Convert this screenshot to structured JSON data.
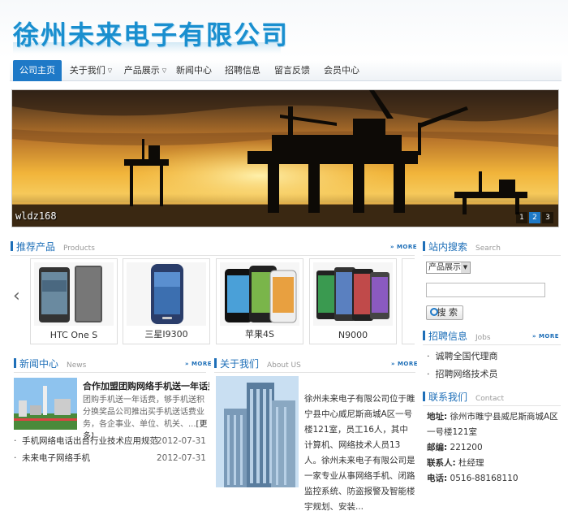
{
  "header": {
    "company_name": "徐州未来电子有限公司"
  },
  "nav": {
    "items": [
      {
        "label": "公司主页",
        "active": true
      },
      {
        "label": "关于我们",
        "dropdown": true
      },
      {
        "label": "产品展示",
        "dropdown": true
      },
      {
        "label": "新闻中心"
      },
      {
        "label": "招聘信息"
      },
      {
        "label": "留言反馈"
      },
      {
        "label": "会员中心"
      }
    ]
  },
  "banner": {
    "caption": "wldz168",
    "pages": [
      "1",
      "2",
      "3"
    ],
    "current_page": "2"
  },
  "products": {
    "title": "推荐产品",
    "title_en": "Products",
    "more": "MORE",
    "items": [
      {
        "name": "HTC One S"
      },
      {
        "name": "三星I9300"
      },
      {
        "name": "苹果4S"
      },
      {
        "name": "N9000"
      }
    ]
  },
  "search": {
    "title": "站内搜索",
    "title_en": "Search",
    "category": "产品展示",
    "button": "搜 索"
  },
  "jobs": {
    "title": "招聘信息",
    "title_en": "Jobs",
    "more": "MORE",
    "items": [
      "诚聘全国代理商",
      "招聘网络技术员"
    ]
  },
  "contact": {
    "title": "联系我们",
    "title_en": "Contact",
    "address_label": "地址:",
    "address": "徐州市睢宁县威尼斯商城A区一号楼121室",
    "zip_label": "邮编:",
    "zip": "221200",
    "person_label": "联系人:",
    "person": "杜经理",
    "phone_label": "电话:",
    "phone": "0516-88168110"
  },
  "news": {
    "title": "新闻中心",
    "title_en": "News",
    "more": "MORE",
    "featured_title": "合作加盟团购网络手机送一年话费...",
    "featured_summary": "团购手机送一年话费，够手机送积分换奖品公司推出买手机送话费业务，各企事业、单位、机关、...",
    "featured_more": "[更多]",
    "list": [
      {
        "title": "手机网络电话出台行业技术应用规范",
        "date": "2012-07-31"
      },
      {
        "title": "未来电子网络手机",
        "date": "2012-07-31"
      }
    ]
  },
  "about": {
    "title": "关于我们",
    "title_en": "About US",
    "more": "MORE",
    "text": "徐州未来电子有限公司位于睢宁县中心威尼斯商城A区一号楼121室，员工16人，其中计算机、网络技术人员13人。徐州未来电子有限公司是一家专业从事网络手机、闭路监控系统、防盗报警及智能楼宇规划、安装..."
  }
}
